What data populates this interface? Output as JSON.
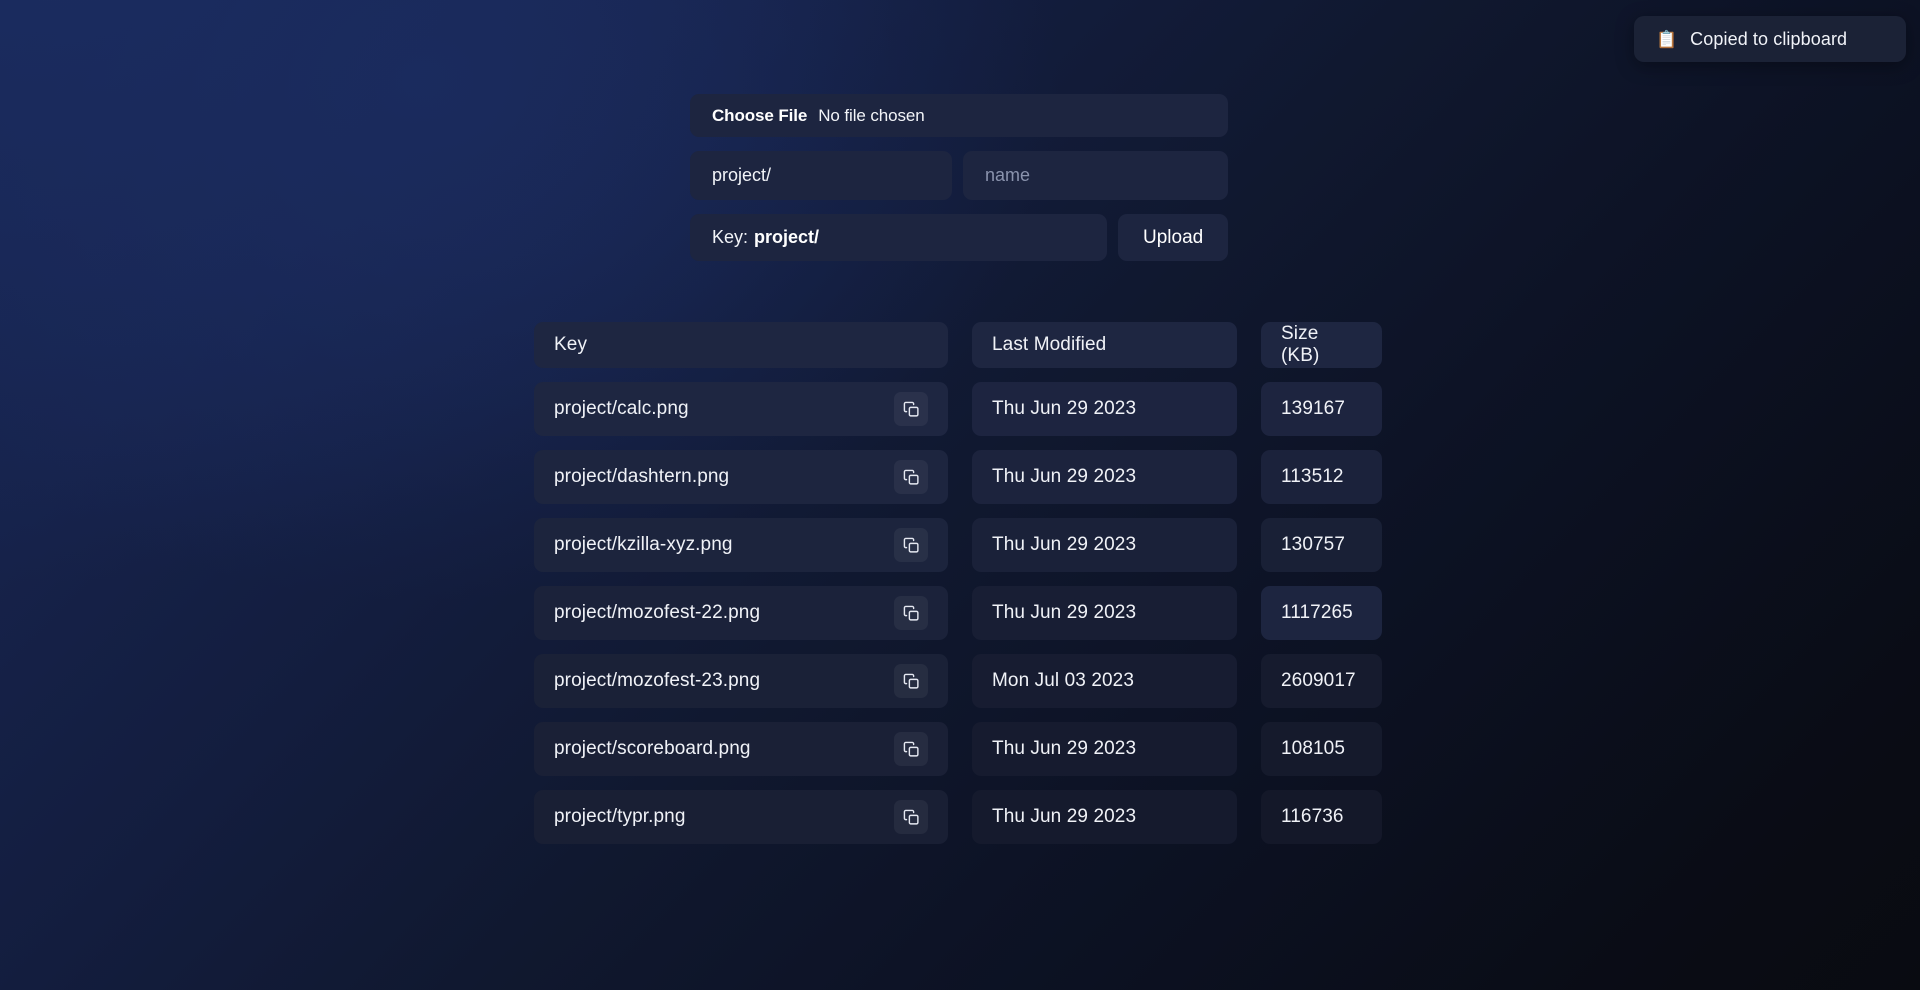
{
  "toast": {
    "icon": "clipboard-icon",
    "icon_glyph": "📋",
    "message": "Copied to clipboard",
    "background": "#1b2236",
    "text_color": "#f1f3f8"
  },
  "upload_form": {
    "file_picker": {
      "button_label": "Choose File",
      "status_text": "No file chosen"
    },
    "prefix_input": {
      "value": "project/",
      "placeholder": ""
    },
    "name_input": {
      "value": "",
      "placeholder": "name"
    },
    "key_preview": {
      "label": "Key:",
      "value": "project/"
    },
    "upload_button_label": "Upload"
  },
  "table": {
    "columns": [
      "Key",
      "Last Modified",
      "Size (KB)"
    ],
    "copy_icon": "copy-icon",
    "rows": [
      {
        "key": "project/calc.png",
        "last_modified": "Thu Jun 29 2023",
        "size": "139167"
      },
      {
        "key": "project/dashtern.png",
        "last_modified": "Thu Jun 29 2023",
        "size": "113512"
      },
      {
        "key": "project/kzilla-xyz.png",
        "last_modified": "Thu Jun 29 2023",
        "size": "130757"
      },
      {
        "key": "project/mozofest-22.png",
        "last_modified": "Thu Jun 29 2023",
        "size": "1117265"
      },
      {
        "key": "project/mozofest-23.png",
        "last_modified": "Mon Jul 03 2023",
        "size": "2609017"
      },
      {
        "key": "project/scoreboard.png",
        "last_modified": "Thu Jun 29 2023",
        "size": "108105"
      },
      {
        "key": "project/typr.png",
        "last_modified": "Thu Jun 29 2023",
        "size": "116736"
      }
    ]
  },
  "theme": {
    "background_top_left": "#16244f",
    "background_bottom_right": "#0a0c15",
    "card": "#1d2540",
    "card_header": "#1e2641",
    "text": "#f0f2f7",
    "placeholder": "#8a93ad"
  }
}
